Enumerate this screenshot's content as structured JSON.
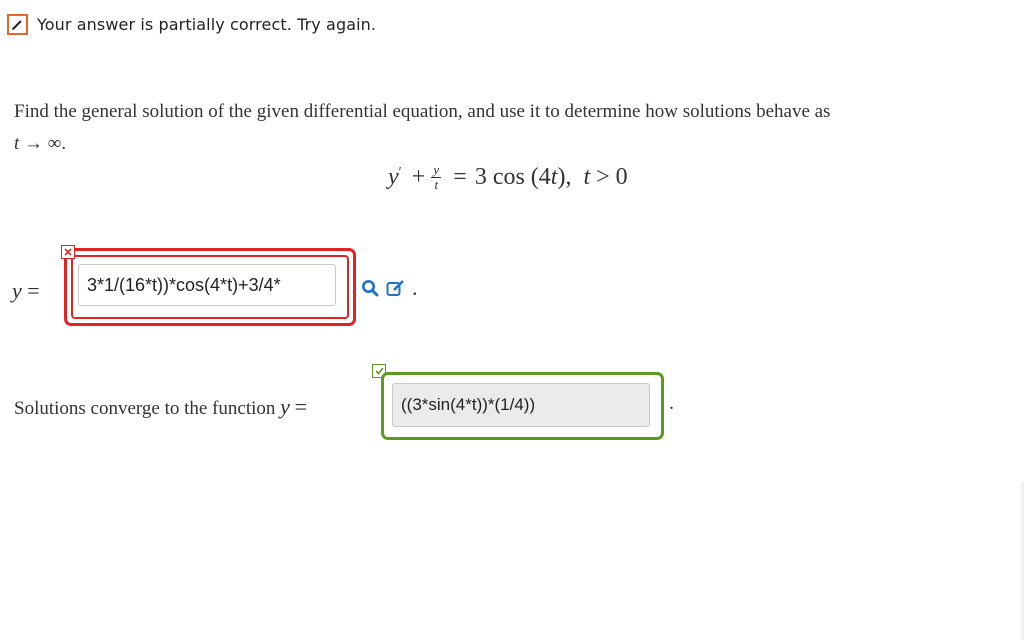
{
  "status": {
    "icon": "pencil-icon",
    "message": "Your answer is partially correct.  Try again."
  },
  "question": {
    "text": "Find the general solution of the given differential equation, and use it to determine how solutions behave as",
    "limit_var": "t",
    "limit_arrow": "→",
    "limit_target": "∞."
  },
  "equation": {
    "y_prime": "y",
    "prime": "′",
    "plus": "+",
    "frac_num": "y",
    "frac_den": "t",
    "equals": "=",
    "rhs": "3 cos (4",
    "rhs_var": "t",
    "rhs_close": "),",
    "cond_var": "t",
    "cond": "> 0"
  },
  "answer1": {
    "label_var": "y",
    "label_eq": "=",
    "value": "3*1/(16*t))*cos(4*t)+3/4*",
    "status": "incorrect",
    "icons": [
      "search-icon",
      "edit-icon"
    ],
    "trailing": "."
  },
  "answer2": {
    "prefix": "Solutions converge to the function",
    "label_var": "y",
    "label_eq": "=",
    "value": "((3*sin(4*t))*(1/4))",
    "status": "correct",
    "trailing": "."
  },
  "colors": {
    "wrong": "#e52222",
    "correct": "#5a9a1e",
    "accent": "#1f74c8",
    "status_icon": "#e8622c"
  }
}
